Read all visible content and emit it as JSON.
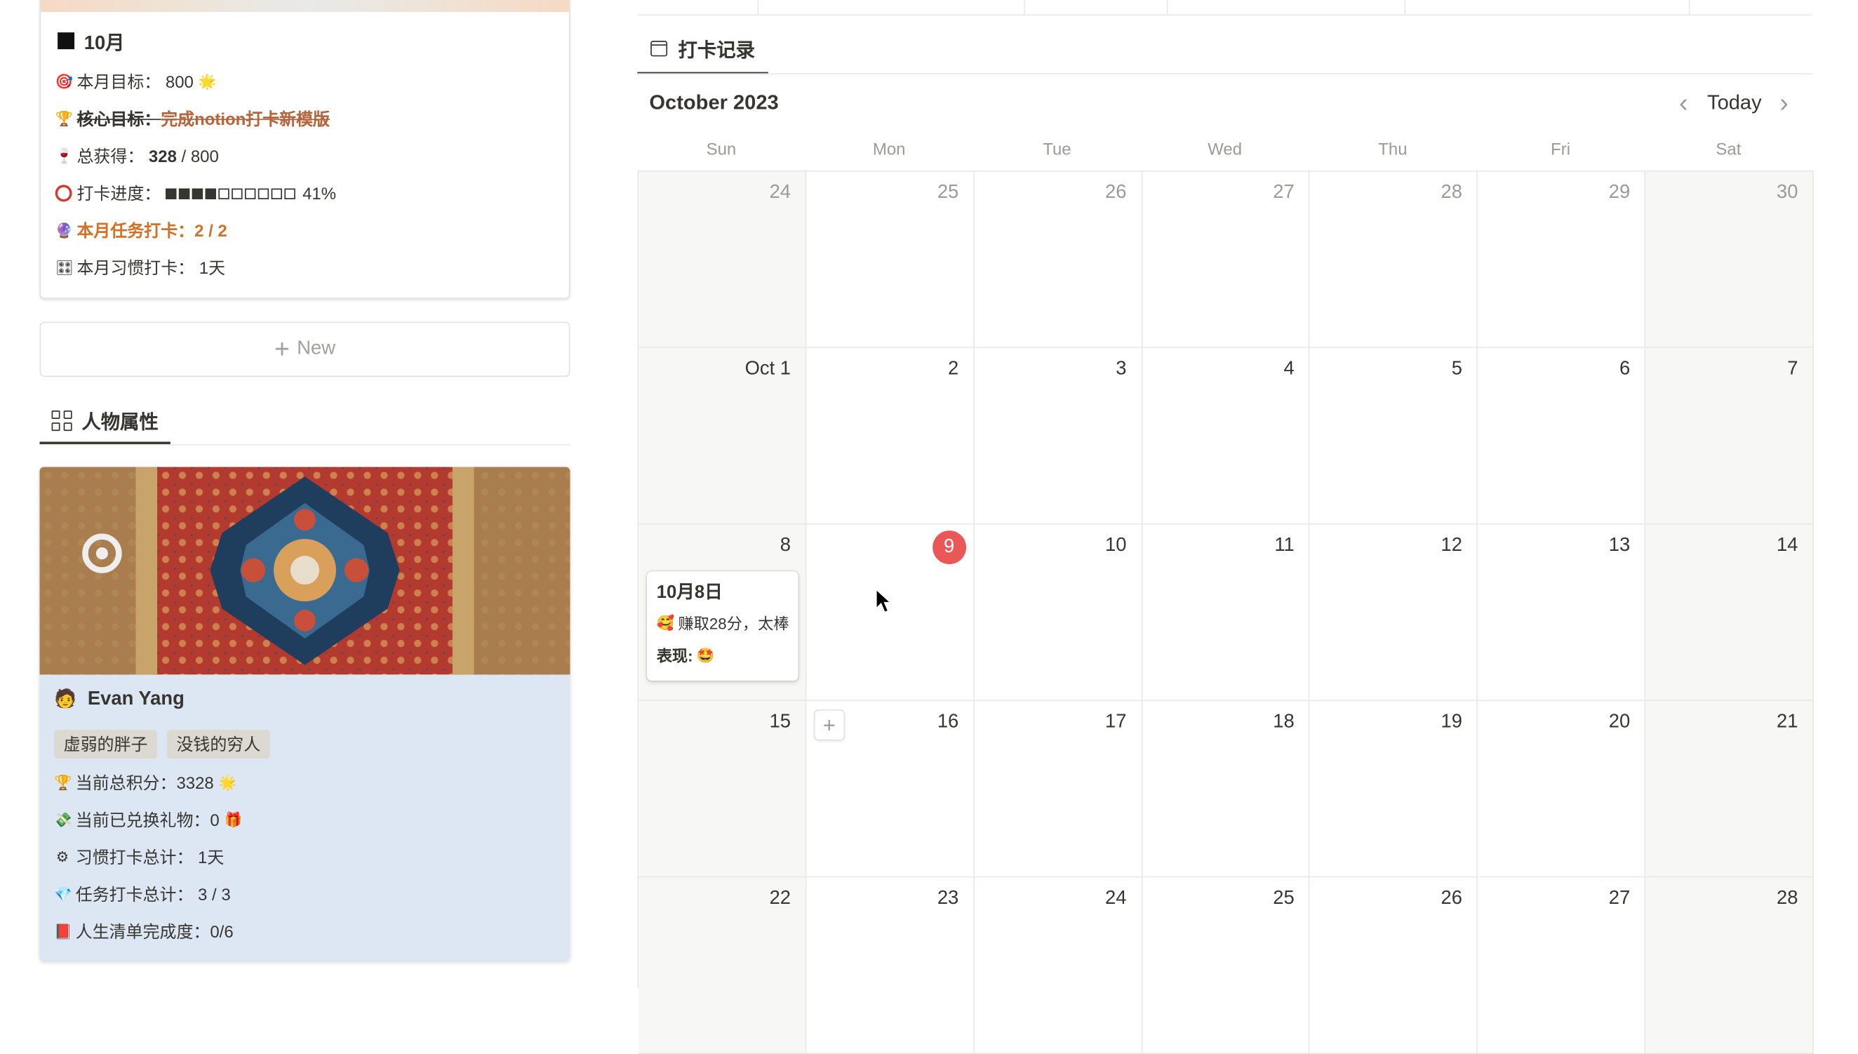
{
  "month_card": {
    "title": "10月",
    "goal_label": "本月目标：",
    "goal_value": "800",
    "core_label": "核心目标：",
    "core_value": "完成notion打卡新模版",
    "earned_label": "总获得：",
    "earned_value": "328",
    "earned_total": "/ 800",
    "progress_label": "打卡进度：",
    "progress_fraction": 0.41,
    "progress_text": "41%",
    "task_label": "本月任务打卡：",
    "task_value": "2 / 2",
    "habit_label": "本月习惯打卡：",
    "habit_value": "1天"
  },
  "new_button": {
    "label": "New"
  },
  "gallery_tab": {
    "label": "人物属性"
  },
  "profile": {
    "name": "Evan Yang",
    "tags": [
      "虚弱的胖子",
      "没钱的穷人"
    ],
    "score_label": "当前总积分：",
    "score_value": "3328",
    "gifts_label": "当前已兑换礼物：",
    "gifts_value": "0",
    "habit_label": "习惯打卡总计：",
    "habit_value": "1天",
    "task_label": "任务打卡总计：",
    "task_value": "3 / 3",
    "life_label": "人生清单完成度：",
    "life_value": "0/6"
  },
  "calendar": {
    "tab_label": "打卡记录",
    "month_label": "October 2023",
    "today_label": "Today",
    "weekdays": [
      "Sun",
      "Mon",
      "Tue",
      "Wed",
      "Thu",
      "Fri",
      "Sat"
    ],
    "weeks": [
      [
        "24",
        "25",
        "26",
        "27",
        "28",
        "29",
        "30"
      ],
      [
        "Oct 1",
        "2",
        "3",
        "4",
        "5",
        "6",
        "7"
      ],
      [
        "8",
        "9",
        "10",
        "11",
        "12",
        "13",
        "14"
      ],
      [
        "15",
        "16",
        "17",
        "18",
        "19",
        "20",
        "21"
      ],
      [
        "22",
        "23",
        "24",
        "25",
        "26",
        "27",
        "28"
      ]
    ],
    "event": {
      "title": "10月8日",
      "line1": "赚取28分，太棒",
      "line2_label": "表现:"
    }
  },
  "colors": {
    "today_badge": "#eb5757",
    "accent_orange": "#d07328",
    "profile_bg": "#dde7f4"
  }
}
